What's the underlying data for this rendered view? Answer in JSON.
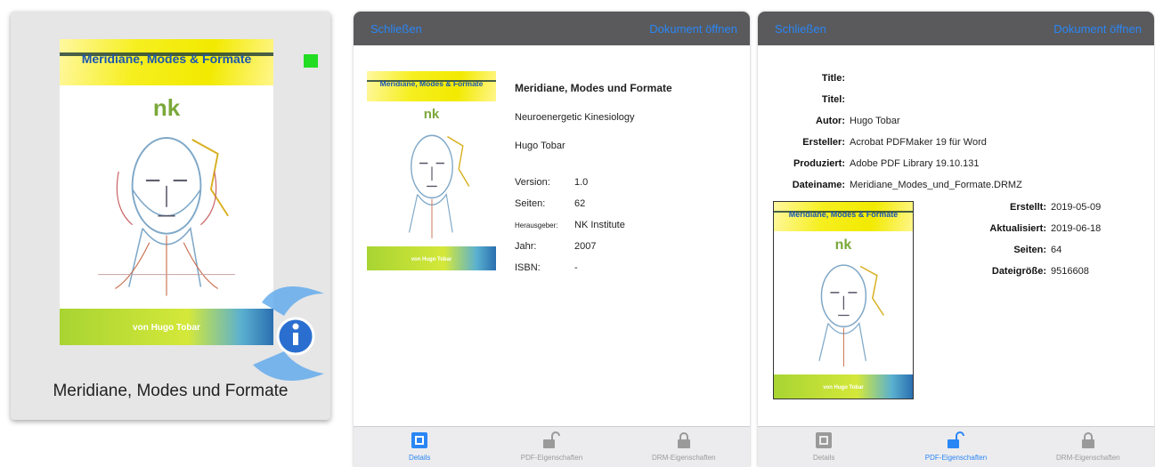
{
  "tile": {
    "title": "Meridiane, Modes und Formate",
    "status_color": "#22dd22"
  },
  "cover": {
    "title": "Meridiane, Modes & Formate",
    "brand": "nk",
    "byline": "von Hugo Tobar"
  },
  "panel_common": {
    "close_label": "Schließen",
    "open_label": "Dokument öffnen",
    "tabs": [
      {
        "label": "Details",
        "icon": "square-icon"
      },
      {
        "label": "PDF-Eigenschaften",
        "icon": "unlock-icon"
      },
      {
        "label": "DRM-Eigenschaften",
        "icon": "lock-icon"
      }
    ]
  },
  "details": {
    "title": "Meridiane, Modes und Formate",
    "subtitle": "Neuroenergetic Kinesiology",
    "author": "Hugo Tobar",
    "fields": [
      {
        "label": "Version:",
        "value": "1.0"
      },
      {
        "label": "Seiten:",
        "value": "62"
      },
      {
        "label": "Herausgeber:",
        "value": "NK Institute"
      },
      {
        "label": "Jahr:",
        "value": "2007"
      },
      {
        "label": "ISBN:",
        "value": "-"
      }
    ],
    "active_tab": "Details"
  },
  "pdf_properties": {
    "fields": [
      {
        "label": "Title:",
        "value": ""
      },
      {
        "label": "Titel:",
        "value": ""
      },
      {
        "label": "Autor:",
        "value": "Hugo Tobar"
      },
      {
        "label": "Ersteller:",
        "value": "Acrobat PDFMaker 19 für Word"
      },
      {
        "label": "Produziert:",
        "value": "Adobe PDF Library 19.10.131"
      },
      {
        "label": "Dateiname:",
        "value": "Meridiane_Modes_und_Formate.DRMZ"
      }
    ],
    "side_fields": [
      {
        "label": "Erstellt:",
        "value": "2019-05-09"
      },
      {
        "label": "Aktualisiert:",
        "value": "2019-06-18"
      },
      {
        "label": "Seiten:",
        "value": "64"
      },
      {
        "label": "Dateigröße:",
        "value": "9516608"
      }
    ],
    "active_tab": "PDF-Eigenschaften"
  },
  "colors": {
    "accent": "#2a86f5",
    "header": "#5a5a5c",
    "tabbar": "#ececee"
  }
}
